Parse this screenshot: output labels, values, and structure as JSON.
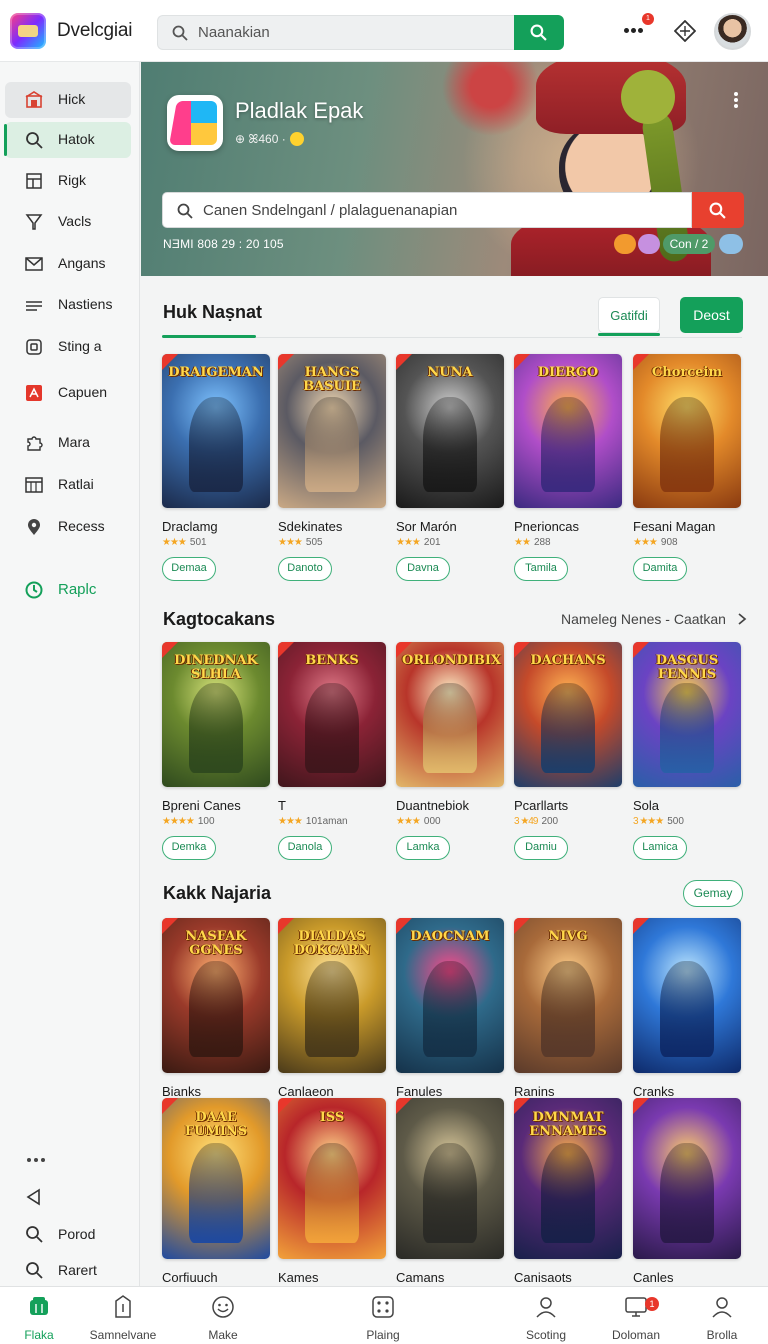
{
  "header": {
    "app_name": "Dvelcgiai",
    "search_placeholder": "Naanakian",
    "notification_count": "1"
  },
  "sidebar": {
    "items": [
      {
        "label": "Hick",
        "icon": "home-icon"
      },
      {
        "label": "Hatok",
        "icon": "search-icon"
      },
      {
        "label": "Rigk",
        "icon": "grid-icon"
      },
      {
        "label": "Vacls",
        "icon": "filter-icon"
      },
      {
        "label": "Angans",
        "icon": "mail-icon"
      },
      {
        "label": "Nastiens",
        "icon": "list-icon"
      },
      {
        "label": "Sting a",
        "icon": "square-icon"
      },
      {
        "label": "Capuen",
        "icon": "pdf-icon"
      },
      {
        "label": "Mara",
        "icon": "puzzle-icon"
      },
      {
        "label": "Ratlai",
        "icon": "table-icon"
      },
      {
        "label": "Recess",
        "icon": "location-icon"
      },
      {
        "label": "Raplc",
        "icon": "clock-icon"
      }
    ],
    "footer": [
      {
        "label": "",
        "icon": "more-icon"
      },
      {
        "label": "",
        "icon": "back-icon"
      },
      {
        "label": "Porod",
        "icon": "search-icon"
      },
      {
        "label": "Rarert",
        "icon": "search-icon"
      }
    ]
  },
  "hero": {
    "title": "Pladlak Epak",
    "subtitle": "⊕ ꕤ460 ·",
    "search_placeholder": "Canen Sndelnganl / plalaguenanapian",
    "meta": "NƎMI  808 29 : 20 105",
    "chips": [
      {
        "label": "",
        "color": "#f29a2e"
      },
      {
        "label": "",
        "color": "#c690e0"
      },
      {
        "label": "Con / 2",
        "color": "#4f9a68"
      },
      {
        "label": "",
        "color": "#8ec0e6"
      }
    ]
  },
  "section1": {
    "title": "Huk Naṣnat",
    "tab1": "Gatifdi",
    "tab2": "Deost",
    "cards": [
      {
        "art": "DRAIGEMAN",
        "name": "Draclamg",
        "stars": "★★★",
        "rating": "501",
        "button": "Demaa"
      },
      {
        "art": "HANGS BASUIE",
        "name": "Sdekinates",
        "stars": "★★★",
        "rating": "505",
        "button": "Danoto"
      },
      {
        "art": "NUNA",
        "name": "Sor Marón",
        "stars": "★★★",
        "rating": "201",
        "button": "Davna"
      },
      {
        "art": "DIERGO",
        "name": "Pnerioncas",
        "stars": "★★",
        "rating": "288",
        "button": "Tamila"
      },
      {
        "art": "Chorceim",
        "name": "Fesani Magan",
        "stars": "★★★",
        "rating": "908",
        "button": "Damita"
      }
    ]
  },
  "section2": {
    "title": "Kagtocakans",
    "see_more": "Nameleg Nenes - Caatkan",
    "cards": [
      {
        "art": "DINEDNAK SLHLA",
        "name": "Bpreni Canes",
        "stars": "★★★★",
        "rating": "100",
        "button": "Demka"
      },
      {
        "art": "BENKS",
        "name": "T",
        "stars": "★★★",
        "rating": "101aman",
        "button": "Danola"
      },
      {
        "art": "ORLONDIBIX",
        "name": "Duantnebiok",
        "stars": "★★★",
        "rating": "000",
        "button": "Lamka"
      },
      {
        "art": "DACHANS",
        "name": "Pcarllarts",
        "stars": "3 ★49",
        "rating": "200",
        "button": "Damiu"
      },
      {
        "art": "DASGUS FENNIS",
        "name": "Sola",
        "stars": "3 ★★★",
        "rating": "500",
        "button": "Lamica"
      }
    ]
  },
  "section3": {
    "title": "Kakk Najaria",
    "pill": "Gemay",
    "row1": [
      {
        "art": "NASFAK GGNES",
        "name": "Bianks"
      },
      {
        "art": "DIALDAS DOKCARN",
        "name": "Canlaeon"
      },
      {
        "art": "DAOCNAM",
        "name": "Fanules"
      },
      {
        "art": "NIVG",
        "name": "Ranins"
      },
      {
        "art": "",
        "name": "Cranks"
      }
    ],
    "row2": [
      {
        "art": "DAAE FUMINS",
        "name": "Corfiuuch"
      },
      {
        "art": "ISS",
        "name": "Kames"
      },
      {
        "art": "",
        "name": "Camans"
      },
      {
        "art": "DMNMAT ENNAMES",
        "name": "Canisaots"
      },
      {
        "art": "",
        "name": "Canles"
      }
    ]
  },
  "bottom_nav": [
    {
      "label": "Flaka",
      "icon": "store-icon"
    },
    {
      "label": "Samnelvane",
      "icon": "phone-icon"
    },
    {
      "label": "Make",
      "icon": "smile-icon"
    },
    {
      "label": "Plaing",
      "icon": "dice-icon"
    },
    {
      "label": "Scoting",
      "icon": "user-icon"
    },
    {
      "label": "Doloman",
      "icon": "monitor-icon"
    },
    {
      "label": "Brolla",
      "icon": "user-icon"
    }
  ],
  "bottom_badge": "1",
  "colors": {
    "accent": "#14a05a",
    "danger": "#e8402f",
    "star": "#f4a623"
  }
}
